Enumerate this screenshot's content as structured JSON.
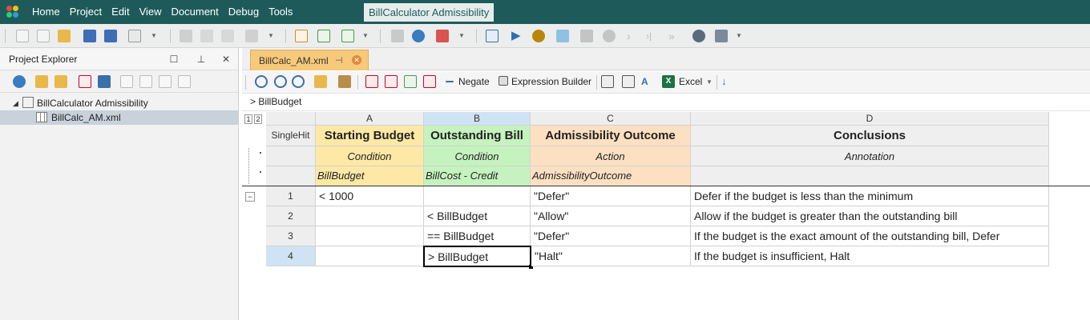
{
  "menu": {
    "items": [
      "Home",
      "Project",
      "Edit",
      "View",
      "Document",
      "Debug",
      "Tools"
    ],
    "window_title": "BillCalculator Admissibility"
  },
  "explorer": {
    "title": "Project Explorer",
    "tree": [
      {
        "label": "BillCalculator Admissibility",
        "expanded": true
      },
      {
        "label": "BillCalc_AM.xml",
        "selected": true
      }
    ]
  },
  "editor": {
    "tab_label": "BillCalc_AM.xml",
    "toolbar": {
      "negate_label": "Negate",
      "expression_builder_label": "Expression Builder",
      "excel_label": "Excel"
    },
    "formula": "> BillBudget"
  },
  "grid": {
    "group_buttons": [
      "1",
      "2"
    ],
    "columns": [
      "A",
      "B",
      "C",
      "D"
    ],
    "hit_policy": "SingleHit",
    "headers": [
      {
        "title": "Starting Budget",
        "type": "Condition",
        "expression": "BillBudget"
      },
      {
        "title": "Outstanding Bill",
        "type": "Condition",
        "expression": "BillCost - Credit"
      },
      {
        "title": "Admissibility Outcome",
        "type": "Action",
        "expression": "AdmissibilityOutcome"
      },
      {
        "title": "Conclusions",
        "type": "Annotation",
        "expression": ""
      }
    ],
    "rows": [
      {
        "num": "1",
        "a": "< 1000",
        "b": "",
        "c": "\"Defer\"",
        "d": "Defer if the budget is less than the minimum"
      },
      {
        "num": "2",
        "a": "",
        "b": "< BillBudget",
        "c": "\"Allow\"",
        "d": "Allow if the budget is greater than the outstanding bill"
      },
      {
        "num": "3",
        "a": "",
        "b": "== BillBudget",
        "c": "\"Defer\"",
        "d": "If the budget is the exact amount of the outstanding bill, Defer"
      },
      {
        "num": "4",
        "a": "",
        "b": "> BillBudget",
        "c": "\"Halt\"",
        "d": "If the budget is insufficient, Halt"
      }
    ],
    "selected_column": "B",
    "selected_row": "4"
  },
  "colors": {
    "menubar": "#1f5a5a",
    "condition_a": "#fde8a6",
    "condition_b": "#c5f2be",
    "action": "#fde0c2",
    "tab": "#f7c97a",
    "selection": "#cfe3f5"
  }
}
